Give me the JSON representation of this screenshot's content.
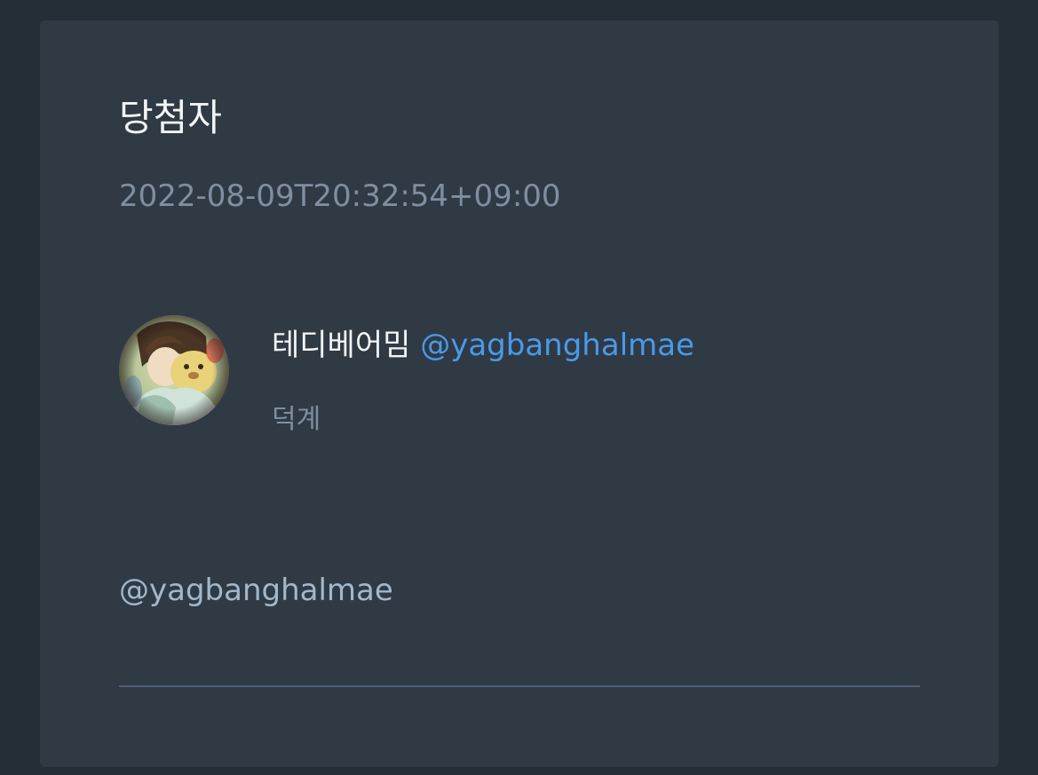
{
  "card": {
    "title": "당첨자",
    "timestamp": "2022-08-09T20:32:54+09:00"
  },
  "winner": {
    "display_name": "테디베어밈",
    "handle": "@yagbanghalmae",
    "bio": "덕계",
    "avatar_icon": "user-avatar-image"
  },
  "comment": {
    "text": "@yagbanghalmae"
  },
  "colors": {
    "page_background": "#252d36",
    "card_background": "#2f3a45",
    "primary_text": "#f2f4f6",
    "muted_text": "#7f8fa0",
    "link": "#4a9ae8",
    "comment_text": "#a3b7c9",
    "divider": "#4d5f72"
  }
}
